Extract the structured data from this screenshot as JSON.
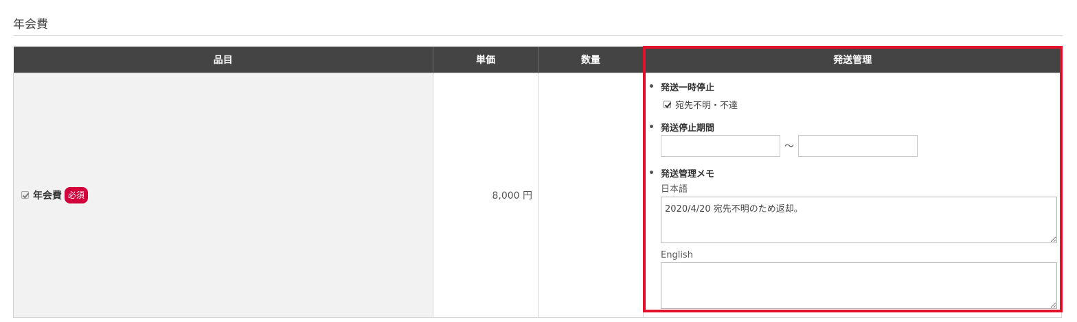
{
  "section": {
    "title": "年会費"
  },
  "table": {
    "headers": {
      "item": "品目",
      "unit_price": "単価",
      "quantity": "数量",
      "shipping": "発送管理"
    },
    "row": {
      "item_name": "年会費",
      "item_checked": true,
      "required_badge": "必須",
      "unit_price": "8,000 円",
      "quantity": ""
    }
  },
  "shipping": {
    "suspend_label": "発送一時停止",
    "suspend_option_label": "宛先不明・不達",
    "suspend_option_checked": true,
    "period_label": "発送停止期間",
    "period_start_value": "",
    "period_separator": "～",
    "period_end_value": "",
    "memo_label": "発送管理メモ",
    "memo_ja_label": "日本語",
    "memo_ja_value": "2020/4/20 宛先不明のため返却。",
    "memo_en_label": "English",
    "memo_en_value": ""
  },
  "colors": {
    "header_bg": "#444444",
    "item_cell_bg": "#f2f2f2",
    "badge_bg": "#d1003b",
    "highlight_border": "#e2102b"
  }
}
